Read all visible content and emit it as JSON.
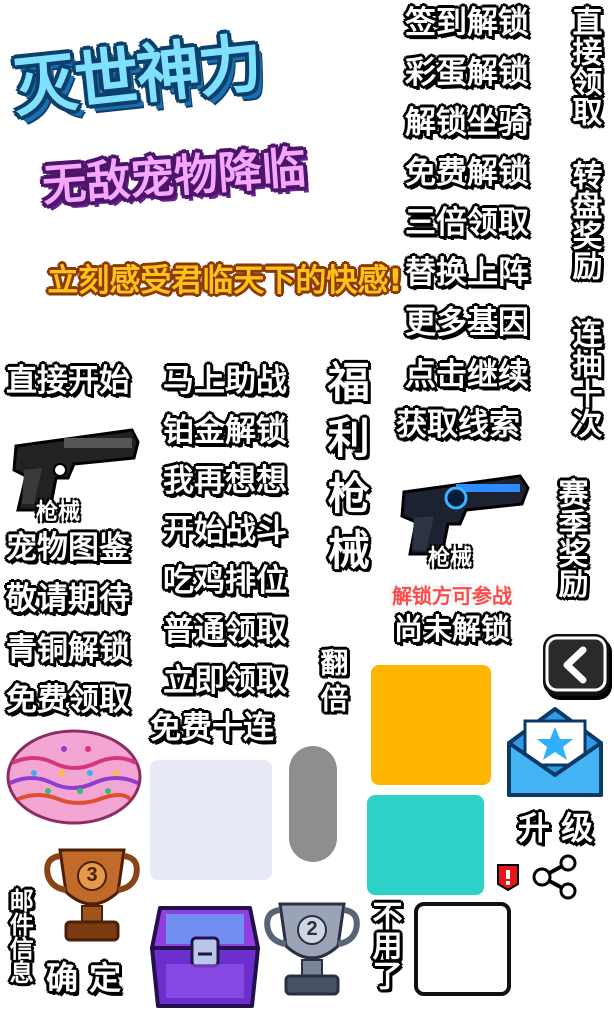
{
  "title": "灭世神力",
  "subtitle": "无敌宠物降临",
  "slogan": "立刻感受君临天下的快感!",
  "left_column": [
    "直接开始",
    "宠物图鉴",
    "敬请期待",
    "青铜解锁",
    "免费领取"
  ],
  "middle_column": [
    "马上助战",
    "铂金解锁",
    "我再想想",
    "开始战斗",
    "吃鸡排位",
    "普通领取",
    "立即领取",
    "免费十连"
  ],
  "right_column": [
    "签到解锁",
    "彩蛋解锁",
    "解锁坐骑",
    "免费解锁",
    "三倍领取",
    "替换上阵",
    "更多基因",
    "点击继续",
    "获取线索"
  ],
  "vertical_far_right": [
    "直接领取",
    "转盘奖励",
    "连抽十次",
    "赛季奖励"
  ],
  "vertical_center": "福利枪械",
  "vertical_double": "翻倍",
  "gun_label_1": "枪械",
  "gun_label_2": "枪械",
  "unlock_to_play": "解锁方可参战",
  "not_unlocked": "尚未解锁",
  "upgrade": "升 级",
  "confirm": "确 定",
  "mail_info": "邮件信息",
  "no_need": "不用了",
  "trophy_bronze_rank": "3",
  "trophy_silver_rank": "2",
  "colors": {
    "swatch_yellow": "#ffb600",
    "swatch_teal": "#2dd1c7",
    "swatch_lavender": "#e8eaf8",
    "pill_gray": "#8e8e8e"
  },
  "icons": [
    "pistol-icon",
    "blue-pistol-icon",
    "back-arrow-icon",
    "mail-star-icon",
    "share-icon",
    "alert-badge-icon",
    "easter-egg-icon",
    "bronze-trophy-icon",
    "silver-trophy-icon",
    "treasure-chest-icon"
  ]
}
